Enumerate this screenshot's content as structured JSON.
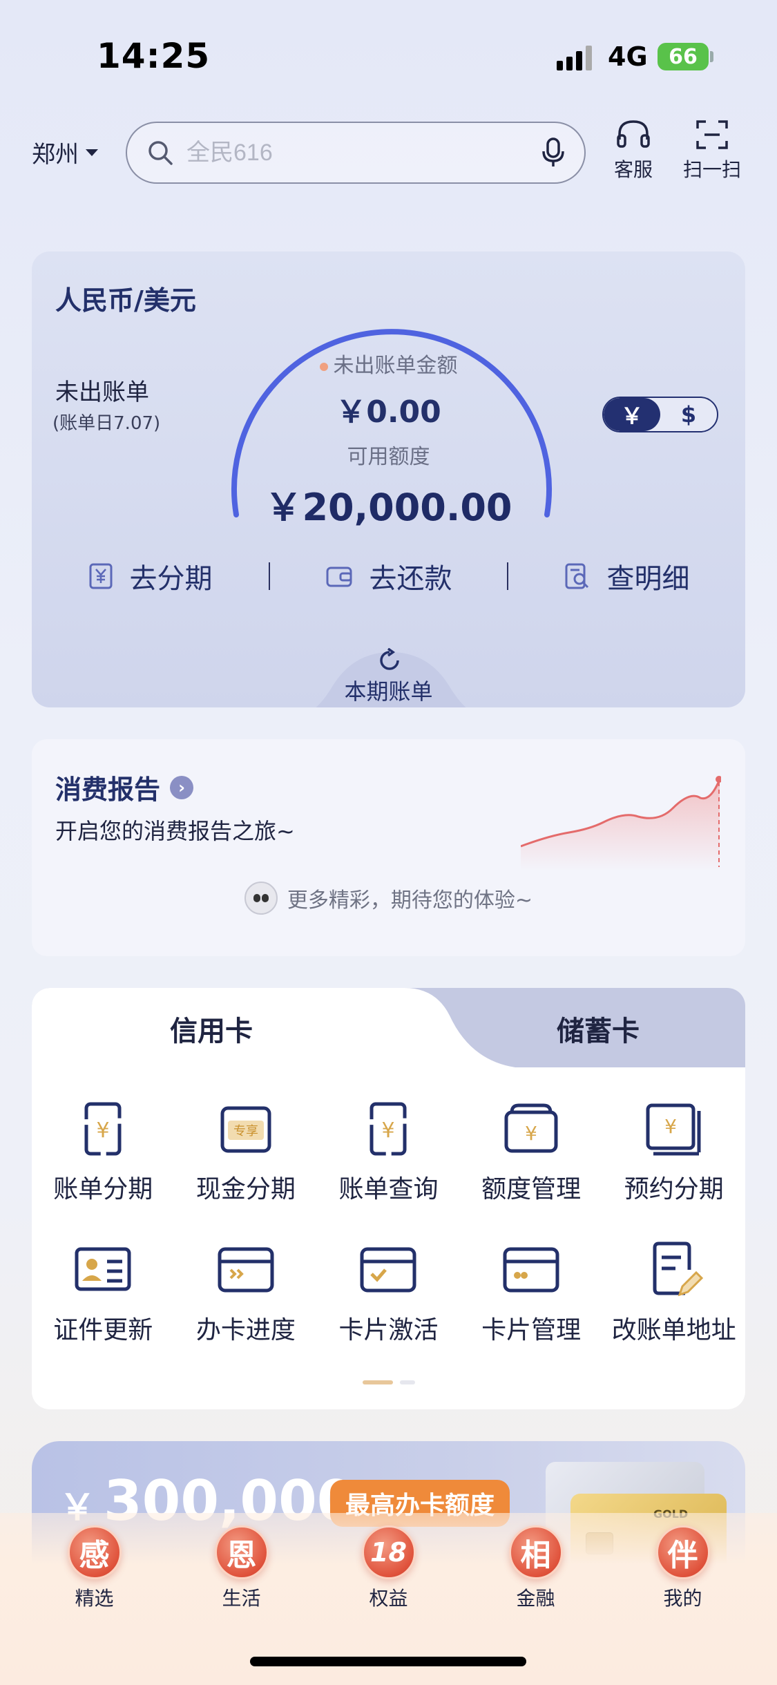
{
  "status_bar": {
    "time": "14:25",
    "network": "4G",
    "battery": "66"
  },
  "header": {
    "city": "郑州",
    "search_placeholder": "全民616",
    "service_label": "客服",
    "scan_label": "扫一扫"
  },
  "bill_card": {
    "title": "人民币/美元",
    "unbilled_label": "未出账单",
    "bill_day": "(账单日7.07)",
    "unbilled_amount_label": "未出账单金额",
    "unbilled_amount": "￥0.00",
    "available_label": "可用额度",
    "available_amount": "￥20,000.00",
    "currency_rmb": "￥",
    "currency_usd": "$",
    "actions": [
      "去分期",
      "去还款",
      "查明细"
    ],
    "current_bill_label": "本期账单",
    "colors": {
      "gauge": "#4f63e0",
      "unbilled_dot": "#f0a080",
      "available_dot": "#4f63e0"
    }
  },
  "report": {
    "title": "消费报告",
    "subtitle": "开启您的消费报告之旅~",
    "more": "更多精彩，期待您的体验~"
  },
  "card_tabs": {
    "tabs": [
      "信用卡",
      "储蓄卡"
    ],
    "items": [
      {
        "label": "账单分期",
        "icon": "bill-installment-icon"
      },
      {
        "label": "现金分期",
        "icon": "cash-installment-icon"
      },
      {
        "label": "账单查询",
        "icon": "bill-query-icon"
      },
      {
        "label": "额度管理",
        "icon": "limit-management-icon"
      },
      {
        "label": "预约分期",
        "icon": "reserve-installment-icon"
      },
      {
        "label": "证件更新",
        "icon": "id-update-icon"
      },
      {
        "label": "办卡进度",
        "icon": "application-progress-icon"
      },
      {
        "label": "卡片激活",
        "icon": "card-activation-icon"
      },
      {
        "label": "卡片管理",
        "icon": "card-management-icon"
      },
      {
        "label": "改账单地址",
        "icon": "change-address-icon"
      }
    ],
    "badge_text": "专享"
  },
  "promo": {
    "currency": "￥",
    "amount": "300,000",
    "badge": "最高办卡额度",
    "card_text": "GOLD"
  },
  "bottom_nav": [
    {
      "glyph": "感",
      "label": "精选"
    },
    {
      "glyph": "恩",
      "label": "生活"
    },
    {
      "glyph": "18",
      "label": "权益"
    },
    {
      "glyph": "相",
      "label": "金融"
    },
    {
      "glyph": "伴",
      "label": "我的"
    }
  ]
}
